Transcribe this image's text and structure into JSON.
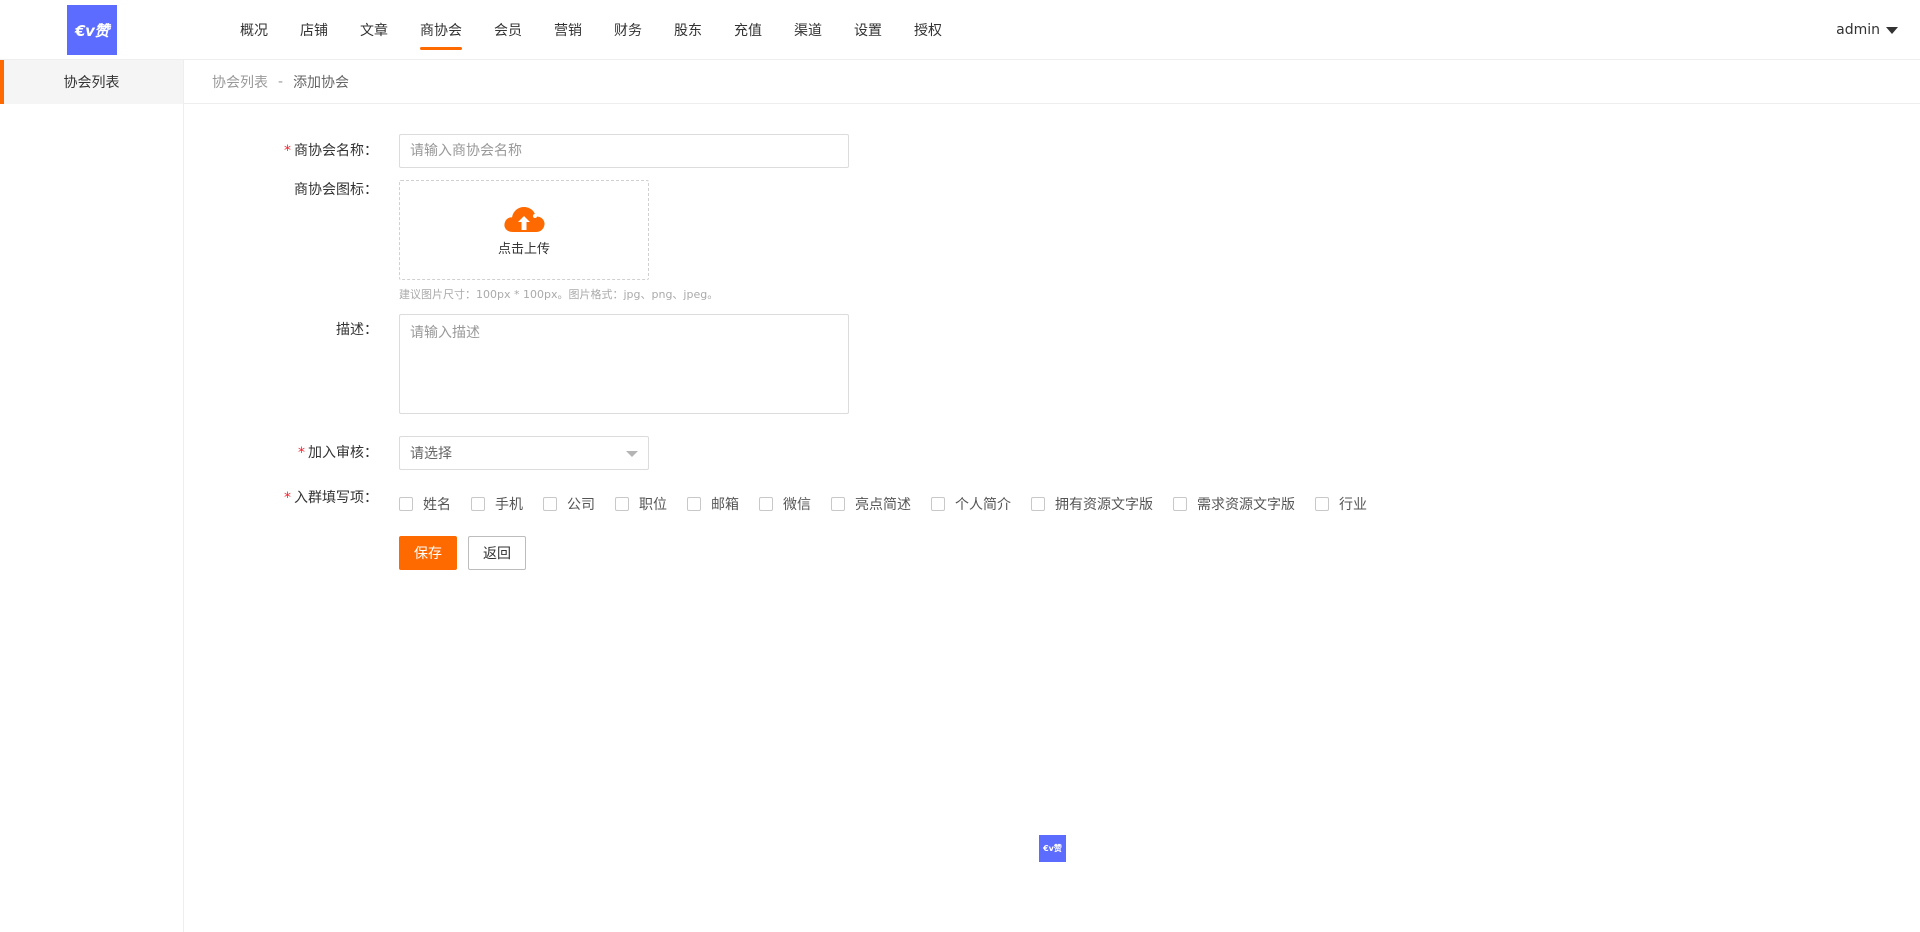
{
  "brand": {
    "logo_text": "€v赞",
    "accent_color": "#ff6a00",
    "logo_bg": "#5b6cff"
  },
  "nav": {
    "items": [
      {
        "label": "概况"
      },
      {
        "label": "店铺"
      },
      {
        "label": "文章"
      },
      {
        "label": "商协会",
        "active": true
      },
      {
        "label": "会员"
      },
      {
        "label": "营销"
      },
      {
        "label": "财务"
      },
      {
        "label": "股东"
      },
      {
        "label": "充值"
      },
      {
        "label": "渠道"
      },
      {
        "label": "设置"
      },
      {
        "label": "授权"
      }
    ],
    "user": "admin"
  },
  "sidebar": {
    "items": [
      {
        "label": "协会列表",
        "active": true
      }
    ]
  },
  "breadcrumb": {
    "parent": "协会列表",
    "separator": "-",
    "current": "添加协会"
  },
  "form": {
    "name": {
      "required_mark": "*",
      "label": "商协会名称：",
      "placeholder": "请输入商协会名称"
    },
    "icon": {
      "label": "商协会图标：",
      "upload_text": "点击上传",
      "hint": "建议图片尺寸：100px * 100px。图片格式：jpg、png、jpeg。"
    },
    "description": {
      "label": "描述：",
      "placeholder": "请输入描述"
    },
    "review": {
      "required_mark": "*",
      "label": "加入审核：",
      "selected": "请选择"
    },
    "fields": {
      "required_mark": "*",
      "label": "入群填写项：",
      "options": [
        {
          "label": "姓名",
          "checked": false
        },
        {
          "label": "手机",
          "checked": false
        },
        {
          "label": "公司",
          "checked": false
        },
        {
          "label": "职位",
          "checked": false
        },
        {
          "label": "邮箱",
          "checked": false
        },
        {
          "label": "微信",
          "checked": false
        },
        {
          "label": "亮点简述",
          "checked": false
        },
        {
          "label": "个人简介",
          "checked": false
        },
        {
          "label": "拥有资源文字版",
          "checked": false
        },
        {
          "label": "需求资源文字版",
          "checked": false
        },
        {
          "label": "行业",
          "checked": false
        }
      ]
    },
    "save_label": "保存",
    "back_label": "返回"
  },
  "footer": {
    "logo_text": "€v赞"
  }
}
